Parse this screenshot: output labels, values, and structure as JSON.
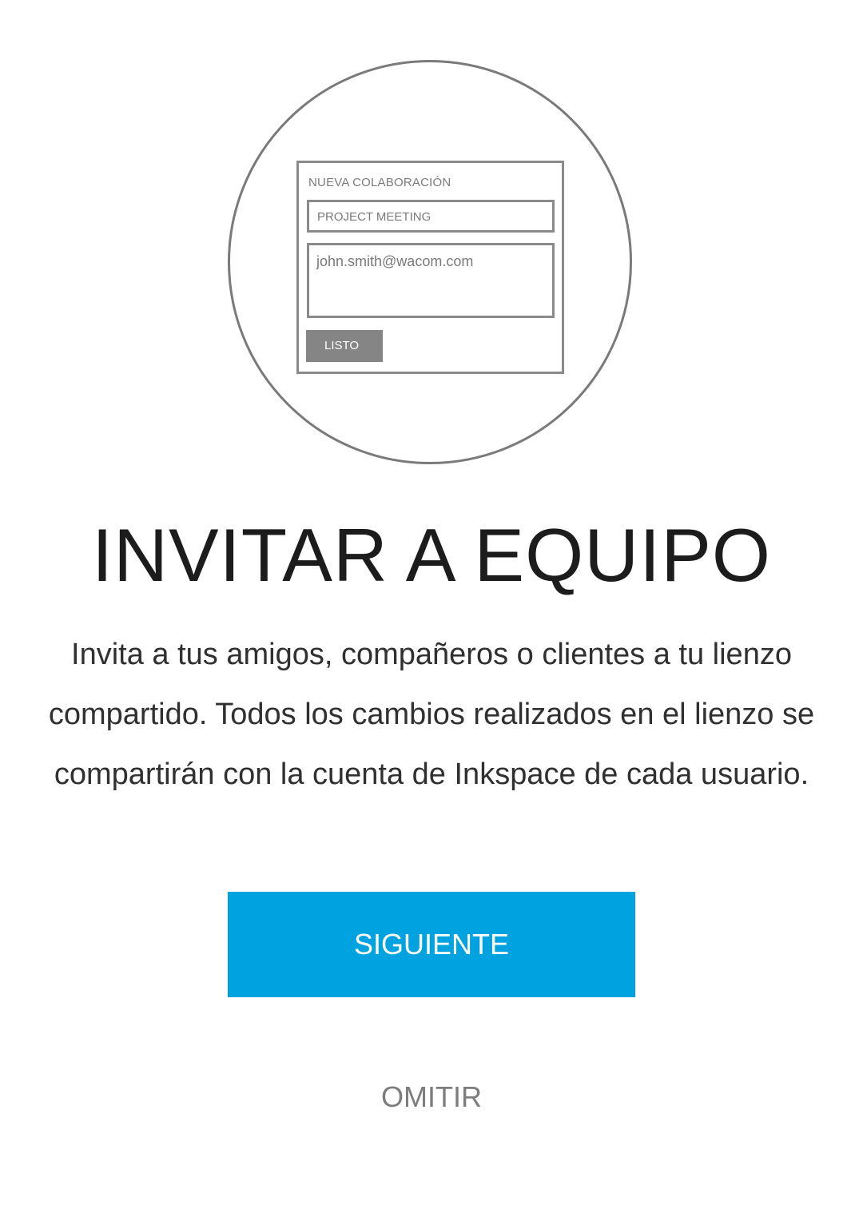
{
  "illustration": {
    "dialog_title": "NUEVA COLABORACIÓN",
    "name_field_value": "PROJECT MEETING",
    "email_field_value": "john.smith@wacom.com",
    "done_button_label": "LISTO"
  },
  "title": "INVITAR A EQUIPO",
  "description": "Invita a tus amigos, compañeros o clientes a tu lienzo compartido. Todos los cambios realizados en el lienzo se compartirán con la cuenta de Inkspace de cada usuario.",
  "buttons": {
    "next_label": "SIGUIENTE",
    "skip_label": "OMITIR"
  },
  "colors": {
    "accent": "#00a2e0",
    "skip_text": "#7d7d7d",
    "illustration_stroke": "#7a7a7a"
  }
}
